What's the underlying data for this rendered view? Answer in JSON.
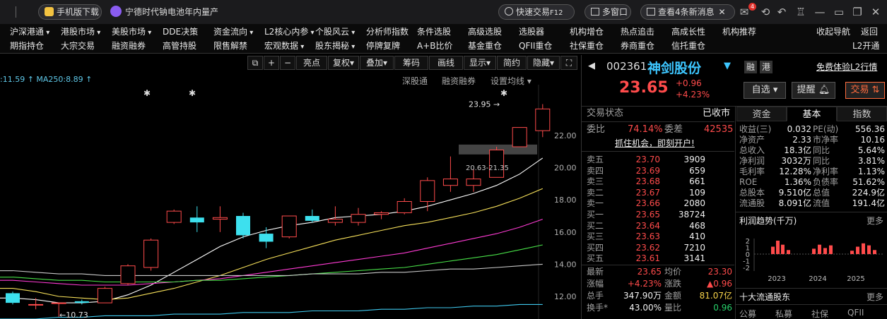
{
  "titlebar": {
    "mobile_download": "手机版下载",
    "news_headline": "宁德时代钠电池年内量产",
    "quick_trade": "快速交易",
    "quick_trade_key": "F12",
    "multi_window": "多窗口",
    "view_news": "查看4条新消息",
    "mail_badge": "4"
  },
  "nav": {
    "row1": [
      "沪深港通",
      "港股市场",
      "美股市场",
      "DDE决策",
      "资金流向",
      "L2核心内参",
      "个股风云",
      "分析师指数",
      "条件选股",
      "高级选股",
      "选股器",
      "机构增仓",
      "热点追击",
      "高成长性",
      "机构推荐",
      "收起导航",
      "返回"
    ],
    "row2": [
      "期指持仓",
      "大宗交易",
      "融资融券",
      "高管持股",
      "限售解禁",
      "宏观数据",
      "股东揭秘",
      "停牌复牌",
      "A+B比价",
      "基金重仓",
      "QFII重仓",
      "社保重仓",
      "券商重仓",
      "信托重仓",
      "L2开通"
    ]
  },
  "chart_toolbar": [
    "亮点",
    "复权",
    "叠加",
    "筹码",
    "画线",
    "显示",
    "简约",
    "隐藏"
  ],
  "chart_tabs": [
    "深股通",
    "融资融券",
    "设置均线"
  ],
  "ma_legend": ":11.59 ↑ MA250:8.89 ↑",
  "chart_data": {
    "type": "candlestick",
    "y_ticks": [
      "22.00",
      "20.00",
      "18.00",
      "16.00",
      "14.00",
      "12.00"
    ],
    "ylim": [
      11.0,
      24.3
    ],
    "annotations": {
      "high_label": "23.95",
      "low_label": "10.73",
      "box_label": "20.63-21.35"
    },
    "candles": [
      {
        "o": 12.2,
        "c": 11.6,
        "h": 12.3,
        "l": 11.5
      },
      {
        "o": 11.5,
        "c": 11.5,
        "h": 11.9,
        "l": 11.2
      },
      {
        "o": 11.6,
        "c": 11.6,
        "h": 11.6,
        "l": 10.73
      },
      {
        "o": 11.7,
        "c": 11.6,
        "h": 11.8,
        "l": 11.5
      },
      {
        "o": 11.6,
        "c": 12.5,
        "h": 12.6,
        "l": 11.6
      },
      {
        "o": 12.8,
        "c": 13.9,
        "h": 14.0,
        "l": 12.7
      },
      {
        "o": 13.8,
        "c": 15.5,
        "h": 15.6,
        "l": 13.6
      },
      {
        "o": 16.6,
        "c": 17.3,
        "h": 17.4,
        "l": 16.5
      },
      {
        "o": 16.9,
        "c": 16.6,
        "h": 17.6,
        "l": 16.0
      },
      {
        "o": 16.8,
        "c": 16.9,
        "h": 17.6,
        "l": 16.0
      },
      {
        "o": 17.0,
        "c": 15.8,
        "h": 17.2,
        "l": 15.6
      },
      {
        "o": 15.9,
        "c": 15.4,
        "h": 16.3,
        "l": 15.0
      },
      {
        "o": 15.7,
        "c": 17.0,
        "h": 17.0,
        "l": 15.6
      },
      {
        "o": 17.0,
        "c": 16.7,
        "h": 17.4,
        "l": 16.6
      },
      {
        "o": 16.6,
        "c": 16.8,
        "h": 17.6,
        "l": 16.4
      },
      {
        "o": 16.6,
        "c": 17.1,
        "h": 17.5,
        "l": 16.4
      },
      {
        "o": 17.1,
        "c": 17.2,
        "h": 17.3,
        "l": 16.8
      },
      {
        "o": 17.2,
        "c": 17.9,
        "h": 18.1,
        "l": 17.1
      },
      {
        "o": 17.9,
        "c": 19.2,
        "h": 19.4,
        "l": 17.3
      },
      {
        "o": 18.9,
        "c": 19.3,
        "h": 20.7,
        "l": 18.5
      },
      {
        "o": 18.9,
        "c": 19.3,
        "h": 19.9,
        "l": 18.5
      },
      {
        "o": 19.4,
        "c": 21.1,
        "h": 21.3,
        "l": 19.4
      },
      {
        "o": 21.3,
        "c": 22.5,
        "h": 22.5,
        "l": 21.3
      },
      {
        "o": 22.3,
        "c": 23.65,
        "h": 23.95,
        "l": 21.9
      }
    ],
    "moving_averages": [
      {
        "color": "#ffffff",
        "values": [
          11.9,
          11.8,
          11.6,
          11.6,
          11.7,
          12.1,
          12.7,
          13.5,
          14.3,
          15.1,
          15.7,
          16.1,
          16.4,
          16.6,
          16.9,
          17.0,
          17.1,
          17.3,
          17.6,
          18.0,
          18.4,
          18.9,
          19.6,
          20.6
        ]
      },
      {
        "color": "#f6e05a",
        "values": [
          12.5,
          12.3,
          12.0,
          11.9,
          11.8,
          11.9,
          12.2,
          12.5,
          12.9,
          13.3,
          13.8,
          14.3,
          14.7,
          15.1,
          15.5,
          15.8,
          16.1,
          16.4,
          16.6,
          16.9,
          17.2,
          17.6,
          18.1,
          18.7
        ]
      },
      {
        "color": "#ff3bd4",
        "values": [
          13.0,
          12.9,
          12.8,
          12.7,
          12.7,
          12.7,
          12.8,
          12.9,
          13.0,
          13.1,
          13.3,
          13.5,
          13.7,
          13.9,
          14.1,
          14.3,
          14.5,
          14.7,
          15.0,
          15.3,
          15.6,
          15.9,
          16.3,
          16.8
        ]
      },
      {
        "color": "#48e048",
        "values": [
          13.2,
          13.1,
          13.0,
          13.0,
          12.9,
          12.9,
          12.9,
          12.9,
          13.0,
          13.0,
          13.1,
          13.2,
          13.3,
          13.4,
          13.5,
          13.6,
          13.7,
          13.8,
          14.0,
          14.2,
          14.4,
          14.6,
          14.9,
          15.2
        ]
      },
      {
        "color": "#c8c8c8",
        "values": [
          13.6,
          13.5,
          13.4,
          13.4,
          13.3,
          13.3,
          13.3,
          13.3,
          13.3,
          13.3,
          13.3,
          13.3,
          13.3,
          13.4,
          13.4,
          13.4,
          13.5,
          13.5,
          13.6,
          13.7,
          13.7,
          13.8,
          13.9,
          14.0
        ]
      },
      {
        "color": "#3fc9ee",
        "values": [
          10.6,
          10.6,
          10.7,
          10.7,
          10.8,
          10.8,
          10.8,
          10.9,
          10.9,
          10.9,
          11.0,
          11.0,
          11.0,
          11.1,
          11.1,
          11.1,
          11.2,
          11.2,
          11.3,
          11.3,
          11.4,
          11.4,
          11.5,
          11.5
        ]
      }
    ]
  },
  "stock": {
    "code": "002361",
    "name": "神剑股份",
    "badge1": "融",
    "badge2": "港",
    "l2_link": "免费体验L2行情",
    "price": "23.65",
    "change": "+0.96",
    "change_pct": "+4.23%",
    "watch_btn": "自选",
    "alert_btn": "提醒",
    "trade_btn": "交易"
  },
  "status": {
    "label": "交易状态",
    "value": "已收市"
  },
  "order": {
    "weibi_label": "委比",
    "weibi": "74.14%",
    "weicha_label": "委差",
    "weicha": "42535",
    "promo": "抓住机会，即刻开户!"
  },
  "asks": [
    {
      "label": "卖五",
      "price": "23.70",
      "vol": "3909"
    },
    {
      "label": "卖四",
      "price": "23.69",
      "vol": "659"
    },
    {
      "label": "卖三",
      "price": "23.68",
      "vol": "661"
    },
    {
      "label": "卖二",
      "price": "23.67",
      "vol": "109"
    },
    {
      "label": "卖一",
      "price": "23.66",
      "vol": "2080"
    }
  ],
  "bids": [
    {
      "label": "买一",
      "price": "23.65",
      "vol": "38724"
    },
    {
      "label": "买二",
      "price": "23.64",
      "vol": "468"
    },
    {
      "label": "买三",
      "price": "23.63",
      "vol": "410"
    },
    {
      "label": "买四",
      "price": "23.62",
      "vol": "7210"
    },
    {
      "label": "买五",
      "price": "23.61",
      "vol": "3141"
    }
  ],
  "summary": [
    {
      "l1": "最新",
      "v1": "23.65",
      "l2": "均价",
      "v2": "23.30"
    },
    {
      "l1": "涨幅",
      "v1": "+4.23%",
      "l2": "涨跌",
      "v2": "▲0.96"
    },
    {
      "l1": "总手",
      "v1": "347.90万",
      "l2": "金额",
      "v2": "81.07亿"
    },
    {
      "l1": "换手*",
      "v1": "43.00%",
      "l2": "量比",
      "v2": "0.96"
    }
  ],
  "tabs3": [
    "资金",
    "基本",
    "指数"
  ],
  "fundamentals": [
    {
      "l1": "收益(三)",
      "v1": "0.032",
      "l2": "PE(动)",
      "v2": "556.36"
    },
    {
      "l1": "净资产",
      "v1": "2.33",
      "l2": "市净率",
      "v2": "10.16"
    },
    {
      "l1": "总收入",
      "v1": "18.3亿",
      "l2": "同比",
      "v2": "5.64%"
    },
    {
      "l1": "净利润",
      "v1": "3032万",
      "l2": "同比",
      "v2": "3.81%"
    },
    {
      "l1": "毛利率",
      "v1": "12.28%",
      "l2": "净利率",
      "v2": "1.13%"
    },
    {
      "l1": "ROE",
      "v1": "1.36%",
      "l2": "负债率",
      "v2": "51.62%"
    },
    {
      "l1": "总股本",
      "v1": "9.510亿",
      "l2": "总值",
      "v2": "224.9亿"
    },
    {
      "l1": "流通股",
      "v1": "8.091亿",
      "l2": "流值",
      "v2": "191.4亿"
    }
  ],
  "profit": {
    "title": "利润趋势(千万)",
    "more": "更多",
    "y_ticks": [
      "2",
      "1",
      "0",
      "-1",
      "-2"
    ],
    "years": [
      "2023",
      "2024",
      "2025"
    ],
    "values": [
      1.1,
      2.0,
      1.4,
      0.6,
      0.8,
      1.4,
      0.9,
      1.3,
      0.5,
      1.1,
      1.6,
      1.3,
      0.6
    ]
  },
  "holders": {
    "title": "十大流通股东",
    "more": "更多",
    "tabs": [
      "公募",
      "私募",
      "社保",
      "QFII"
    ]
  }
}
